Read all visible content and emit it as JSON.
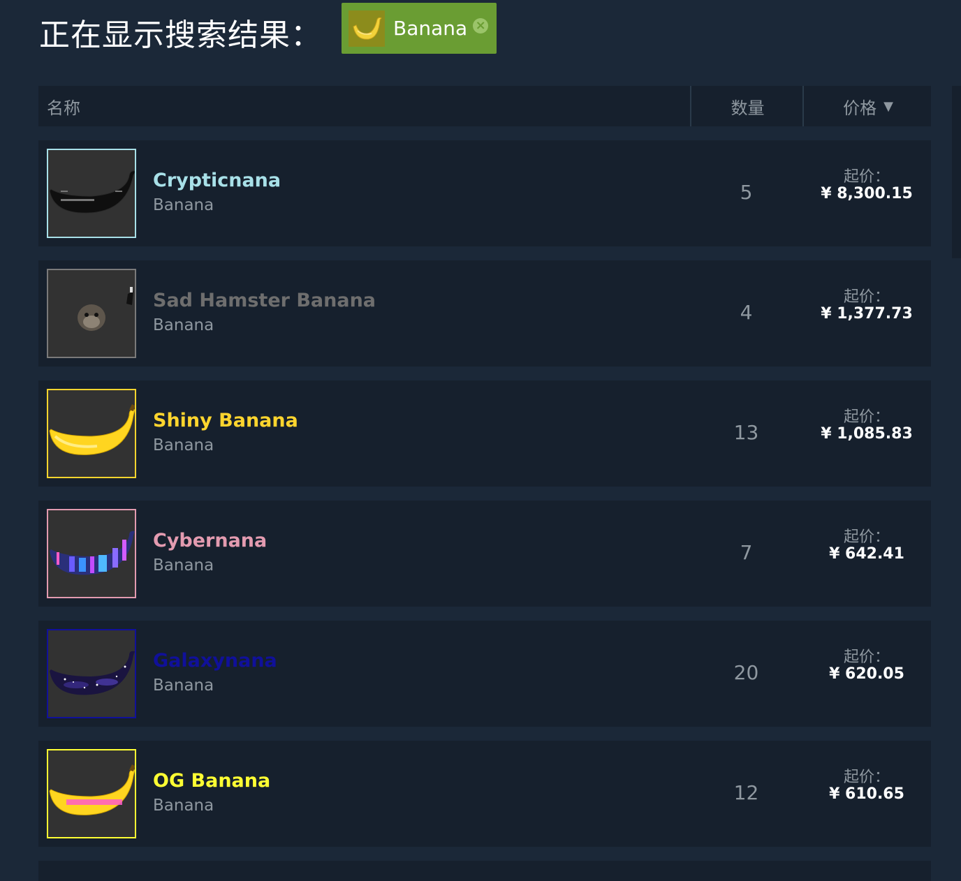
{
  "header": {
    "title": "正在显示搜索结果：",
    "filter_tag": {
      "label": "Banana",
      "icon": "banana-icon",
      "remove_icon": "close-circle-icon"
    }
  },
  "table": {
    "columns": {
      "name": "名称",
      "quantity": "数量",
      "price": "价格",
      "sort_indicator": "▼"
    },
    "rows": [
      {
        "name": "Crypticnana",
        "game": "Banana",
        "quantity": "5",
        "price_label": "起价：",
        "price": "¥ 8,300.15",
        "name_color": "#a8e0e8",
        "border_color": "#a8e0e8",
        "icon": "cryptic-banana-icon"
      },
      {
        "name": "Sad Hamster Banana",
        "game": "Banana",
        "quantity": "4",
        "price_label": "起价：",
        "price": "¥ 1,377.73",
        "name_color": "#6e6e6e",
        "border_color": "#7a7a7a",
        "icon": "hamster-banana-icon"
      },
      {
        "name": "Shiny Banana",
        "game": "Banana",
        "quantity": "13",
        "price_label": "起价：",
        "price": "¥ 1,085.83",
        "name_color": "#ffd52e",
        "border_color": "#ffd52e",
        "icon": "shiny-banana-icon"
      },
      {
        "name": "Cybernana",
        "game": "Banana",
        "quantity": "7",
        "price_label": "起价：",
        "price": "¥ 642.41",
        "name_color": "#e39bb0",
        "border_color": "#e39bb0",
        "icon": "cyber-banana-icon"
      },
      {
        "name": "Galaxynana",
        "game": "Banana",
        "quantity": "20",
        "price_label": "起价：",
        "price": "¥ 620.05",
        "name_color": "#10109a",
        "border_color": "#10109a",
        "icon": "galaxy-banana-icon"
      },
      {
        "name": "OG Banana",
        "game": "Banana",
        "quantity": "12",
        "price_label": "起价：",
        "price": "¥ 610.65",
        "name_color": "#ffff33",
        "border_color": "#ffff33",
        "icon": "og-banana-icon"
      }
    ]
  },
  "colors": {
    "page_background": "#1b2838",
    "row_background": "#16202d",
    "filter_tag_background": "#6a9d33",
    "muted_text": "#8f98a0"
  }
}
